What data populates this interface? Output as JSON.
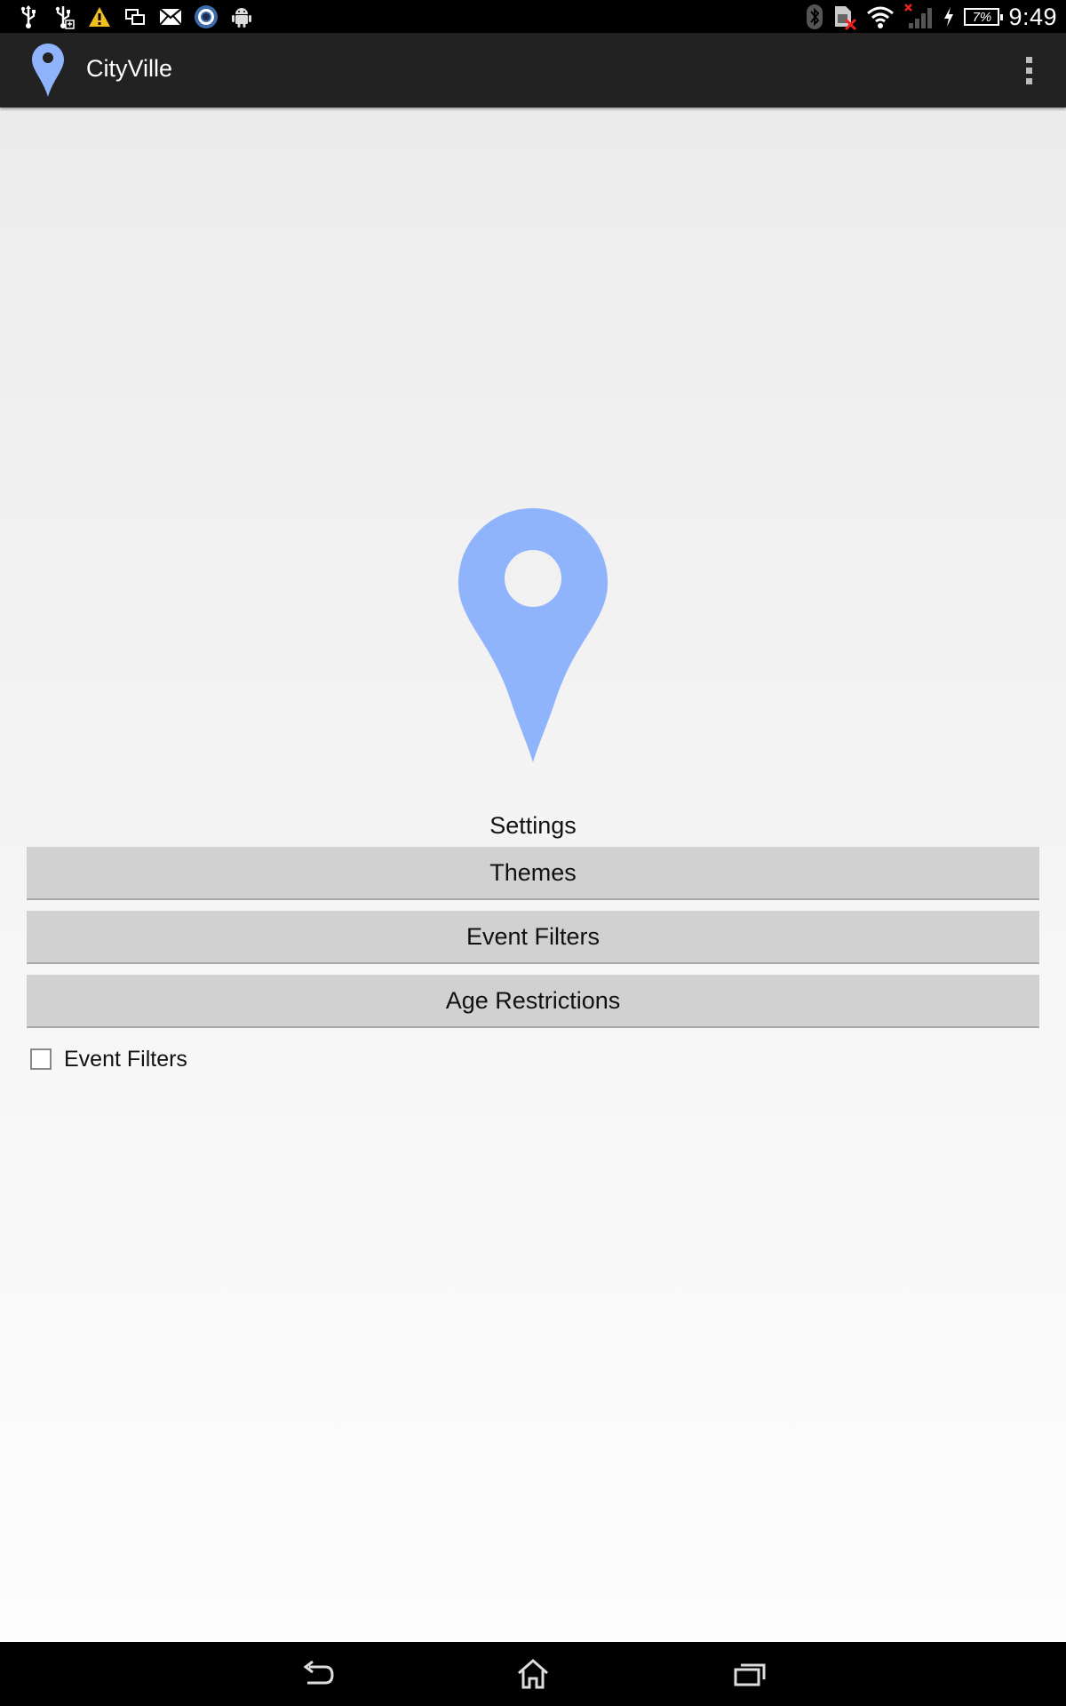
{
  "status_bar": {
    "time": "9:49",
    "battery_percent": "7%",
    "left_icons": [
      "usb-icon",
      "usb-debug-icon",
      "warning-icon",
      "screen-mirror-icon",
      "gmail-icon",
      "camera-app-icon",
      "android-icon"
    ],
    "right_icons": [
      "bluetooth-icon",
      "no-sim-icon",
      "wifi-icon",
      "cell-signal-icon",
      "charging-icon",
      "battery-icon"
    ]
  },
  "action_bar": {
    "title": "CityVille",
    "logo_icon": "map-pin-icon",
    "overflow_icon": "overflow-menu-icon"
  },
  "main": {
    "hero_icon": "map-pin-icon",
    "settings_label": "Settings",
    "buttons": [
      {
        "label": "Themes"
      },
      {
        "label": "Event Filters"
      },
      {
        "label": "Age Restrictions"
      }
    ],
    "checkbox": {
      "label": "Event Filters",
      "checked": false
    }
  },
  "nav_bar": {
    "icons": [
      "back-icon",
      "home-icon",
      "recents-icon"
    ]
  },
  "colors": {
    "accent_pin": "#8fb4fb",
    "action_bar_bg": "#222222",
    "button_bg": "#d1d1d1"
  }
}
